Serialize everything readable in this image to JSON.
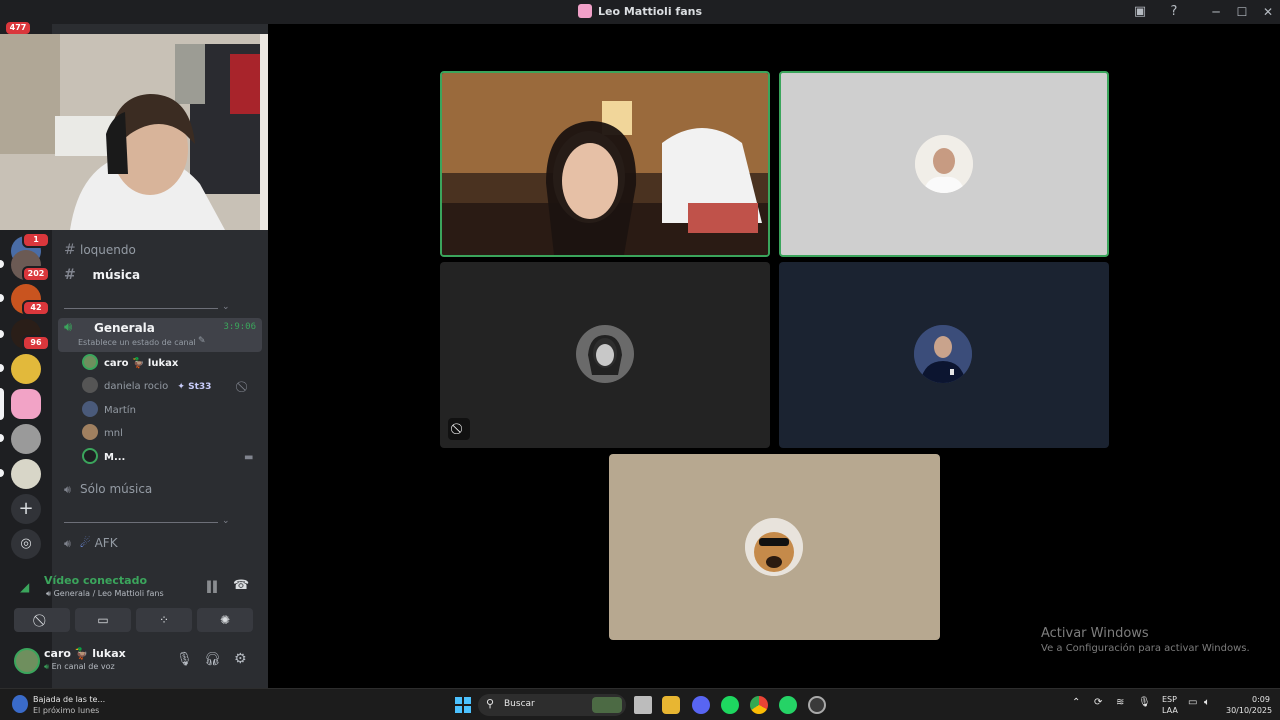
{
  "window": {
    "title": "Leo Mattioli fans",
    "icons": [
      "screen-share-icon",
      "help-icon"
    ],
    "controls": [
      "minimize-icon",
      "maximize-icon",
      "close-icon"
    ]
  },
  "servers": {
    "badges": [
      "477",
      "1",
      "202",
      "42",
      "96"
    ]
  },
  "channels": {
    "text": [
      {
        "name": "loquendo"
      },
      {
        "name": "música"
      }
    ],
    "voice_active": {
      "name": "Generala",
      "timer": "3:9:06",
      "status_placeholder": "Establece un estado de canal"
    },
    "members": [
      {
        "name": "caro 🦆 lukax",
        "highlight": true
      },
      {
        "name": "daniela rocio",
        "tag": "St33"
      },
      {
        "name": "Martín"
      },
      {
        "name": "mnl"
      },
      {
        "name": "M..."
      }
    ],
    "voice_other": [
      {
        "name": "Sólo música"
      },
      {
        "name": "AFK"
      }
    ]
  },
  "voice_panel": {
    "status": "Vídeo conectado",
    "location": "Generala / Leo Mattioli fans",
    "buttons": [
      "camera-off-icon",
      "screen-share-icon",
      "activities-icon",
      "soundboard-icon"
    ]
  },
  "user": {
    "name": "caro 🦆 lukax",
    "status": "En canal de voz",
    "icons": [
      "microphone-icon",
      "headphones-icon",
      "gear-icon"
    ]
  },
  "watermark": {
    "line1": "Activar Windows",
    "line2": "Ve a Configuración para activar Windows."
  },
  "taskbar": {
    "weather_title": "Bajada de las te...",
    "weather_sub": "El próximo lunes",
    "search_placeholder": "Buscar",
    "lang_top": "ESP",
    "lang_bottom": "LAA",
    "time": "0:09",
    "date": "30/10/2025"
  },
  "colors": {
    "accent_green": "#3ba55c",
    "badge_red": "#da373c",
    "bg_dark": "#1e1f22",
    "panel": "#2b2d31"
  }
}
